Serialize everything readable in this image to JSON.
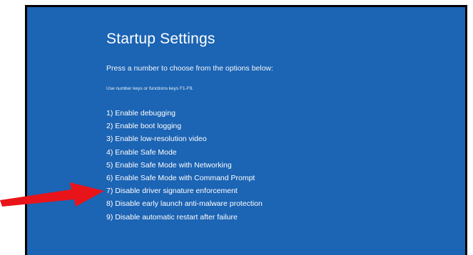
{
  "screen": {
    "title": "Startup Settings",
    "subtitle": "Press a number to choose from the options below:",
    "hint": "Use number keys or functions keys F1-F9.",
    "options": [
      "1) Enable debugging",
      "2) Enable boot logging",
      "3) Enable low-resolution video",
      "4) Enable Safe Mode",
      "5) Enable Safe Mode with Networking",
      "6) Enable Safe Mode with Command Prompt",
      "7) Disable driver signature enforcement",
      "8) Disable early launch anti-malware protection",
      "9) Disable automatic restart after failure"
    ]
  },
  "annotation": {
    "icon": "red-arrow-icon",
    "color": "#e8141a",
    "points_to_option": 7
  },
  "colors": {
    "background": "#1c64b4",
    "text": "#ffffff",
    "frame_border": "#000000"
  }
}
